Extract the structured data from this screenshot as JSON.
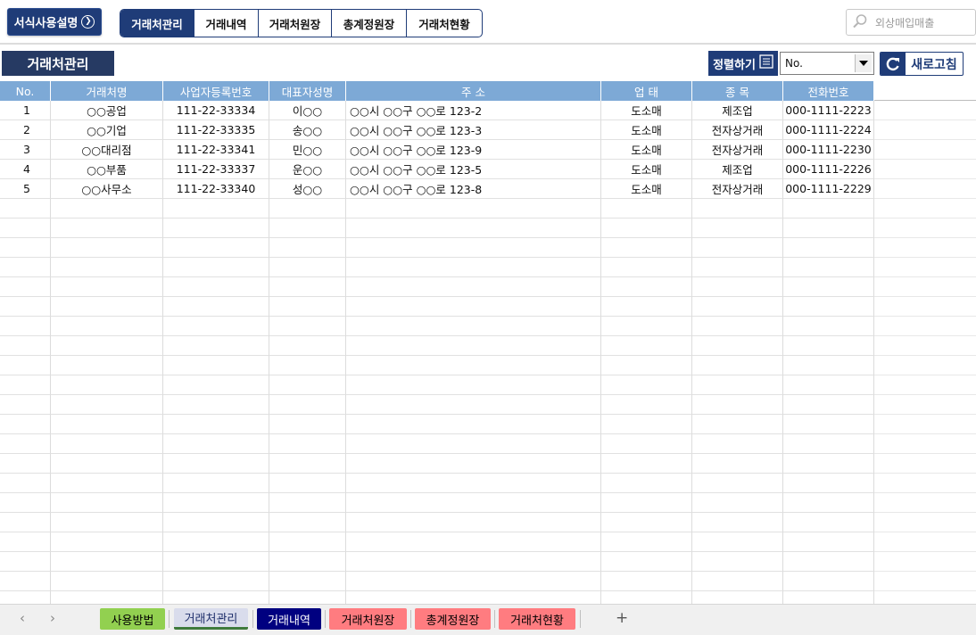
{
  "toolbar": {
    "help_label": "서식사용설명",
    "tabs": [
      "거래처관리",
      "거래내역",
      "거래처원장",
      "총계정원장",
      "거래처현황"
    ],
    "search_placeholder": "외상매입매출"
  },
  "section_title": "거래처관리",
  "sort": {
    "label": "정렬하기",
    "selected": "No."
  },
  "refresh_label": "새로고침",
  "table": {
    "columns": [
      "No.",
      "거래처명",
      "사업자등록번호",
      "대표자성명",
      "주   소",
      "업   태",
      "종   목",
      "전화번호"
    ],
    "rows": [
      [
        "1",
        "○○공업",
        "111-22-33334",
        "이○○",
        "○○시 ○○구 ○○로 123-2",
        "도소매",
        "제조업",
        "000-1111-2223"
      ],
      [
        "2",
        "○○기업",
        "111-22-33335",
        "송○○",
        "○○시 ○○구 ○○로 123-3",
        "도소매",
        "전자상거래",
        "000-1111-2224"
      ],
      [
        "3",
        "○○대리점",
        "111-22-33341",
        "민○○",
        "○○시 ○○구 ○○로 123-9",
        "도소매",
        "전자상거래",
        "000-1111-2230"
      ],
      [
        "4",
        "○○부품",
        "111-22-33337",
        "운○○",
        "○○시 ○○구 ○○로 123-5",
        "도소매",
        "제조업",
        "000-1111-2226"
      ],
      [
        "5",
        "○○사무소",
        "111-22-33340",
        "성○○",
        "○○시 ○○구 ○○로 123-8",
        "도소매",
        "전자상거래",
        "000-1111-2229"
      ]
    ]
  },
  "sheet_tabs": [
    {
      "label": "사용방법",
      "bg": "#92d050",
      "fg": "#000000"
    },
    {
      "label": "거래처관리",
      "bg": "#d9dcec",
      "fg": "#1f2f6b"
    },
    {
      "label": "거래내역",
      "bg": "#000080",
      "fg": "#ffffff"
    },
    {
      "label": "거래처원장",
      "bg": "#ff7c80",
      "fg": "#000000"
    },
    {
      "label": "총계정원장",
      "bg": "#ff7c80",
      "fg": "#000000"
    },
    {
      "label": "거래처현황",
      "bg": "#ff7c80",
      "fg": "#000000"
    }
  ],
  "add_sheet_symbol": "+",
  "colors": {
    "accent": "#1f3c78",
    "header": "#7da9d6",
    "title_bg": "#263a63"
  }
}
